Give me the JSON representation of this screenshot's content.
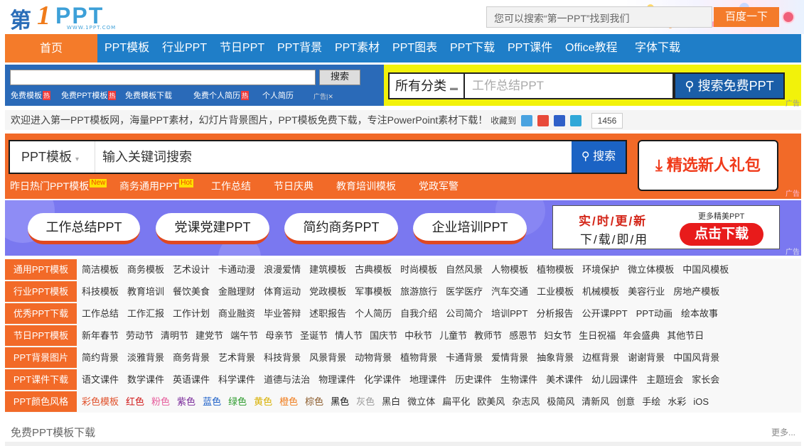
{
  "logo": {
    "char": "第",
    "num": "1",
    "ppt": "PPT",
    "url": "WWW.1PPT.COM"
  },
  "top_search": {
    "placeholder": "您可以搜索“第一PPT”找到我们",
    "button": "百度一下"
  },
  "nav": {
    "home": "首页",
    "items": [
      "PPT模板",
      "行业PPT",
      "节日PPT",
      "PPT背景",
      "PPT素材",
      "PPT图表",
      "PPT下载",
      "PPT课件",
      "Office教程",
      "字体下载"
    ]
  },
  "ad_strip": {
    "search_button": "搜索",
    "links": [
      "免费模板",
      "免费PPT模板",
      "免费模板下载",
      "免费个人简历",
      "个人简历"
    ],
    "hot_icon": "热",
    "ad_label": "广告",
    "category_select": "所有分类",
    "category_input_placeholder": "工作总结PPT",
    "category_button": "搜索免费PPT",
    "corner_ad": "广告"
  },
  "welcome": {
    "text": "欢迎进入第一PPT模板网，海量PPT素材，幻灯片背景图片，PPT模板免费下载，专注PowerPoint素材下载！",
    "fav_label": "收藏到",
    "count": "1456"
  },
  "orange_search": {
    "select": "PPT模板",
    "input_placeholder": "输入关键词搜索",
    "button": "搜索",
    "gift": "精选新人礼包",
    "links": [
      {
        "label": "昨日热门PPT模板",
        "tag": "New"
      },
      {
        "label": "商务通用PPT",
        "tag": "Hot"
      },
      {
        "label": "工作总结",
        "tag": ""
      },
      {
        "label": "节日庆典",
        "tag": ""
      },
      {
        "label": "教育培训模板",
        "tag": ""
      },
      {
        "label": "党政军警",
        "tag": ""
      }
    ],
    "corner_ad": "广告"
  },
  "banner": {
    "pills": [
      "工作总结PPT",
      "党课党建PPT",
      "简约商务PPT",
      "企业培训PPT"
    ],
    "download_line1": "实/时/更/新",
    "download_line2": "下/载/即/用",
    "more": "更多精美PPT",
    "download_button": "点击下载",
    "corner_ad": "广告"
  },
  "categories": [
    {
      "head": "通用PPT模板",
      "items": [
        "简洁模板",
        "商务模板",
        "艺术设计",
        "卡通动漫",
        "浪漫爱情",
        "建筑模板",
        "古典模板",
        "时尚模板",
        "自然风景",
        "人物模板",
        "植物模板",
        "环境保护",
        "微立体模板",
        "中国风模板"
      ]
    },
    {
      "head": "行业PPT模板",
      "items": [
        "科技模板",
        "教育培训",
        "餐饮美食",
        "金融理财",
        "体育运动",
        "党政模板",
        "军事模板",
        "旅游旅行",
        "医学医疗",
        "汽车交通",
        "工业模板",
        "机械模板",
        "美容行业",
        "房地产模板"
      ]
    },
    {
      "head": "优秀PPT下载",
      "items": [
        "工作总结",
        "工作汇报",
        "工作计划",
        "商业融资",
        "毕业答辩",
        "述职报告",
        "个人简历",
        "自我介绍",
        "公司简介",
        "培训PPT",
        "分析报告",
        "公开课PPT",
        "PPT动画",
        "绘本故事"
      ]
    },
    {
      "head": "节日PPT模板",
      "items": [
        "新年春节",
        "劳动节",
        "清明节",
        "建党节",
        "端午节",
        "母亲节",
        "圣诞节",
        "情人节",
        "国庆节",
        "中秋节",
        "儿童节",
        "教师节",
        "感恩节",
        "妇女节",
        "生日祝福",
        "年会盛典",
        "其他节日"
      ]
    },
    {
      "head": "PPT背景图片",
      "items": [
        "简约背景",
        "淡雅背景",
        "商务背景",
        "艺术背景",
        "科技背景",
        "风景背景",
        "动物背景",
        "植物背景",
        "卡通背景",
        "爱情背景",
        "抽象背景",
        "边框背景",
        "谢谢背景",
        "中国风背景"
      ]
    },
    {
      "head": "PPT课件下载",
      "items": [
        "语文课件",
        "数学课件",
        "英语课件",
        "科学课件",
        "道德与法治",
        "物理课件",
        "化学课件",
        "地理课件",
        "历史课件",
        "生物课件",
        "美术课件",
        "幼儿园课件",
        "主题班会",
        "家长会"
      ]
    },
    {
      "head": "PPT颜色风格",
      "items": [
        "彩色模板",
        "红色",
        "粉色",
        "紫色",
        "蓝色",
        "绿色",
        "黄色",
        "橙色",
        "棕色",
        "黑色",
        "灰色",
        "黑白",
        "微立体",
        "扁平化",
        "欧美风",
        "杂志风",
        "极简风",
        "清新风",
        "创意",
        "手绘",
        "水彩",
        "iOS"
      ]
    }
  ],
  "color_styles": {
    "彩色模板": "#e0502a",
    "红色": "#d11a1a",
    "粉色": "#e65a9a",
    "紫色": "#7a2a9a",
    "蓝色": "#1a5ec8",
    "绿色": "#2a9a2a",
    "黄色": "#d8b000",
    "橙色": "#f07b1a",
    "棕色": "#8a5a2a",
    "黑色": "#111111",
    "灰色": "#999999",
    "黑白": "#333333"
  },
  "bottom": {
    "title": "免费PPT模板下载",
    "more": "更多..."
  },
  "colors": {
    "orange": "#f26a28",
    "blue": "#1f7ec8",
    "purple": "#7a78f0",
    "yellow": "#f2f20a"
  }
}
